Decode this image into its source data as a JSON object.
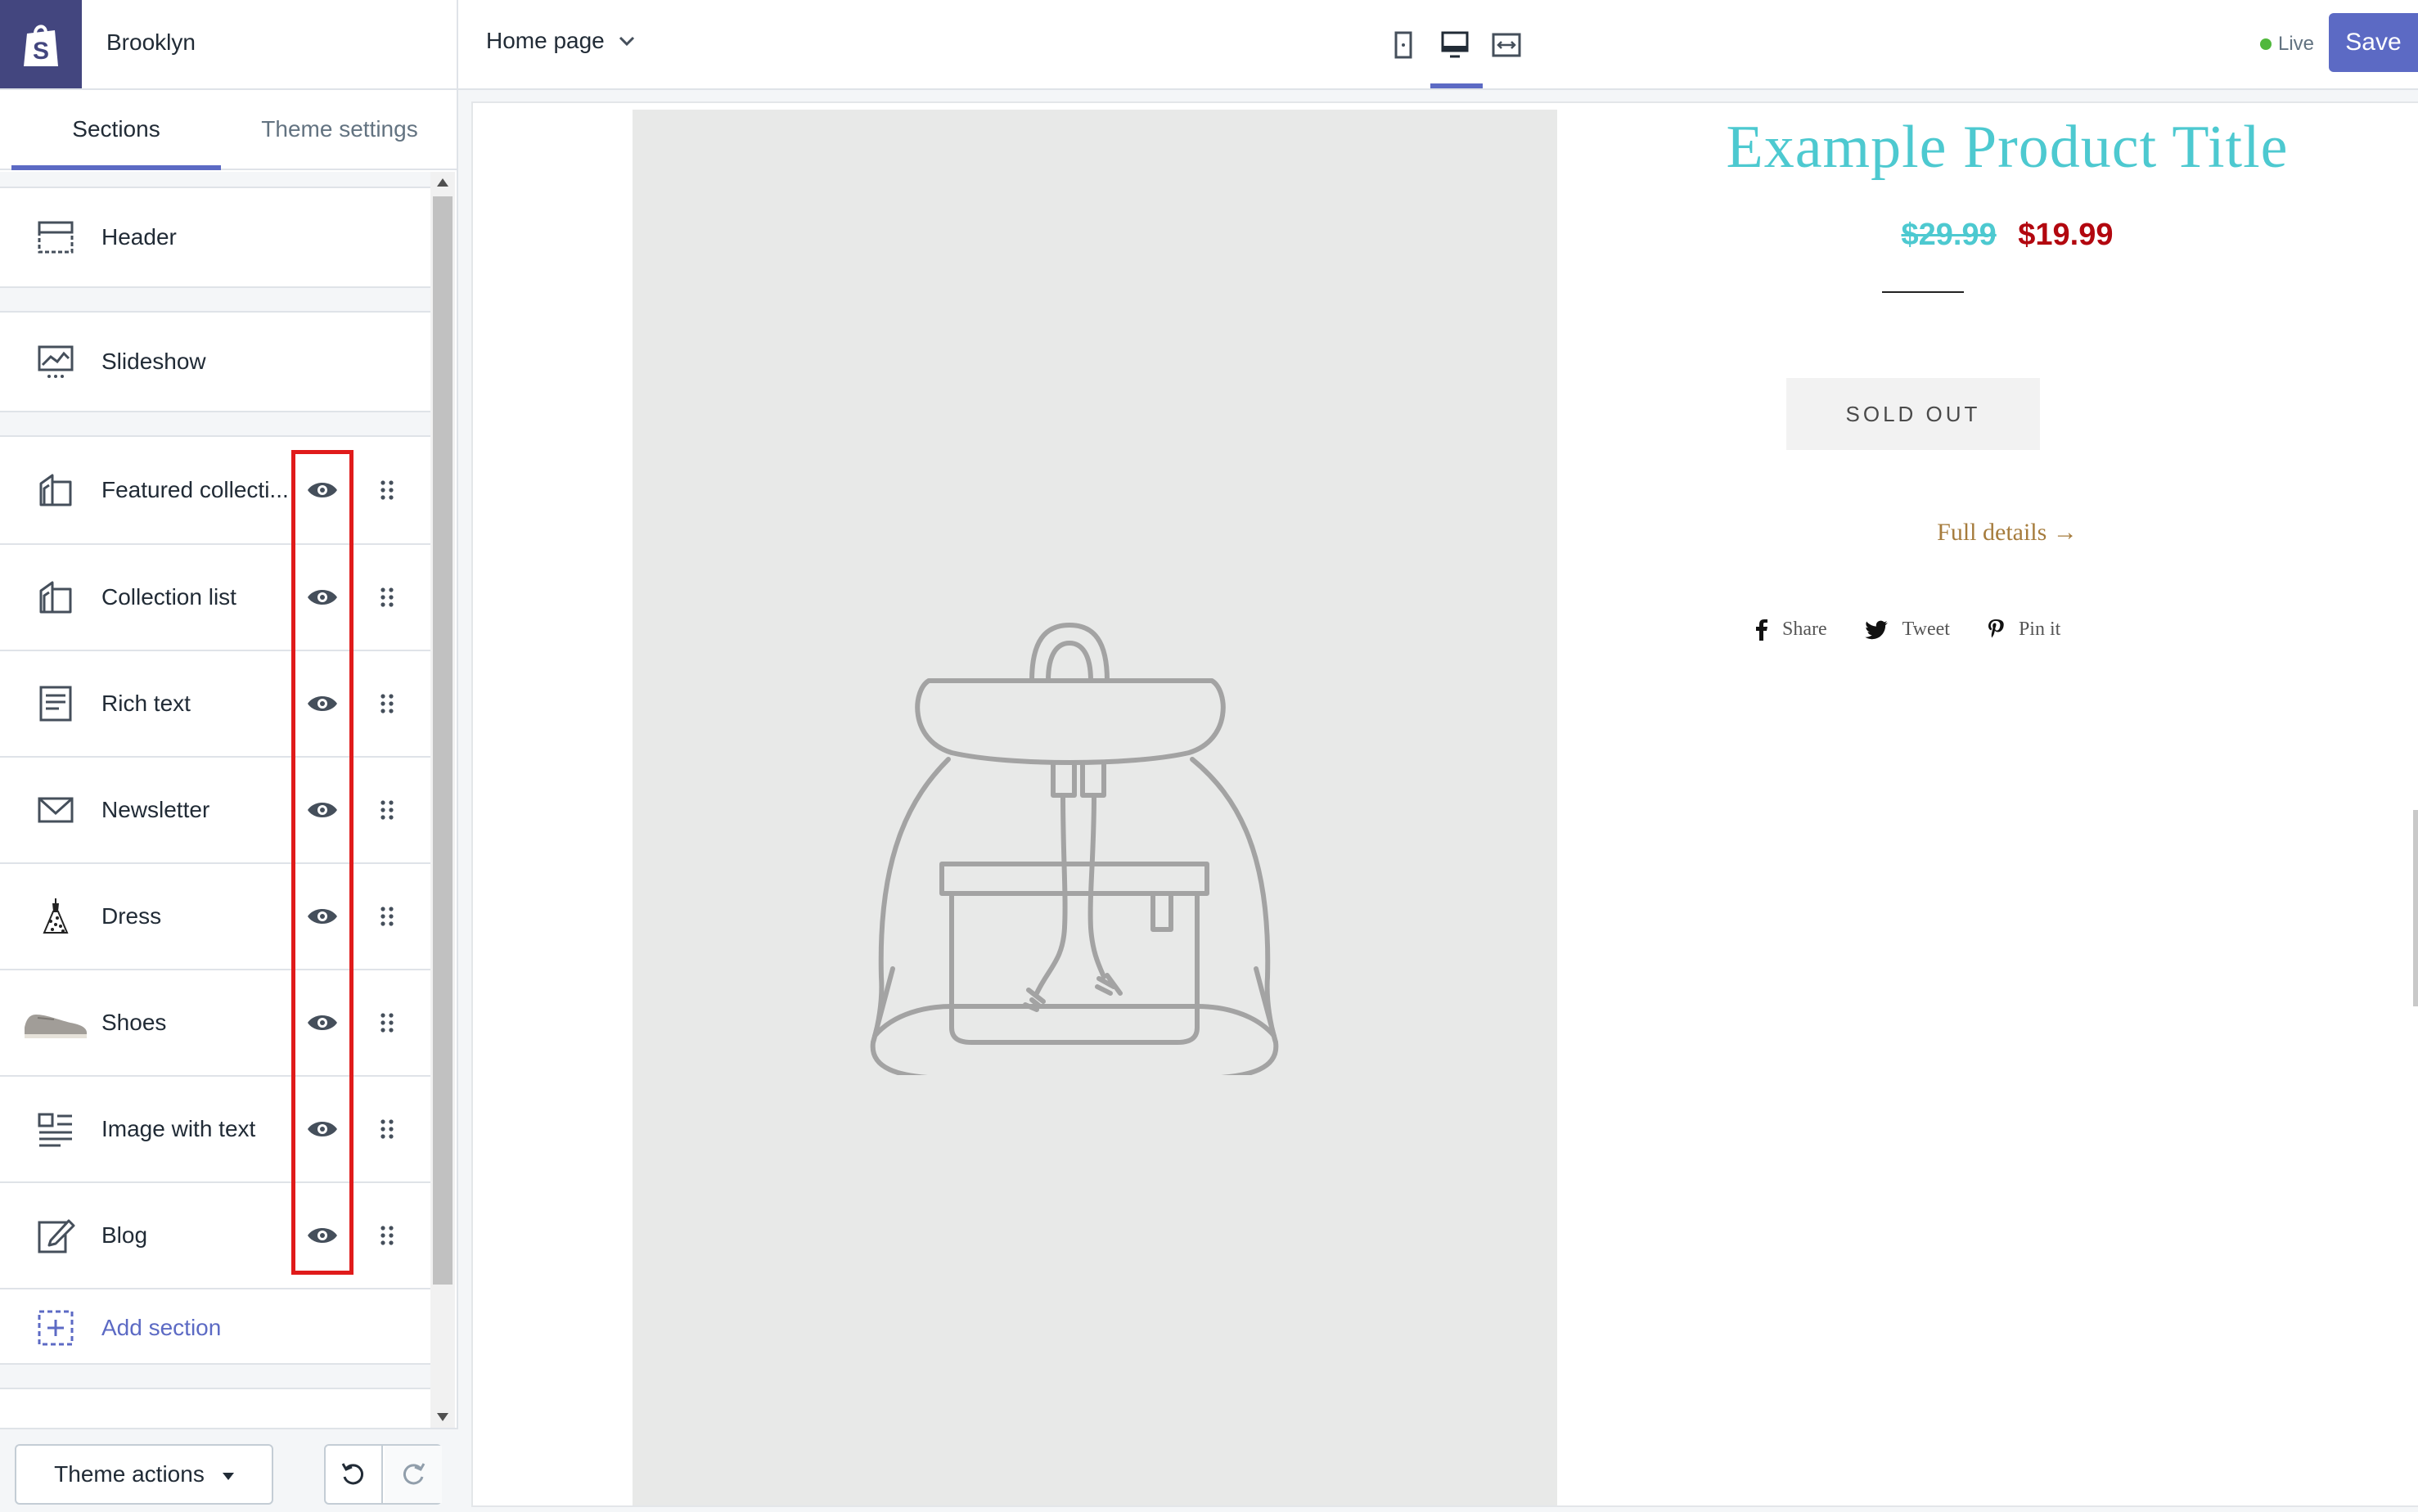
{
  "app": {
    "store_name": "Brooklyn"
  },
  "sidebar": {
    "tabs": [
      "Sections",
      "Theme settings"
    ],
    "fixed_sections": [
      "Header",
      "Slideshow"
    ],
    "sections": [
      {
        "label": "Featured collecti...",
        "icon": "collection-icon"
      },
      {
        "label": "Collection list",
        "icon": "collection-icon"
      },
      {
        "label": "Rich text",
        "icon": "rich-text-icon"
      },
      {
        "label": "Newsletter",
        "icon": "envelope-icon"
      },
      {
        "label": "Dress",
        "icon": "dress-thumbnail"
      },
      {
        "label": "Shoes",
        "icon": "shoes-thumbnail"
      },
      {
        "label": "Image with text",
        "icon": "image-text-icon"
      },
      {
        "label": "Blog",
        "icon": "blog-edit-icon"
      }
    ],
    "add_section": "Add section",
    "footer": {
      "theme_actions": "Theme actions"
    }
  },
  "topbar": {
    "page_select": "Home page",
    "status": "Live",
    "save_label": "Save",
    "active_device": "desktop"
  },
  "preview": {
    "product_title": "Example Product Title",
    "old_price": "$29.99",
    "new_price": "$19.99",
    "sold_out": "SOLD OUT",
    "full_details": "Full details →",
    "share": "Share",
    "tweet": "Tweet",
    "pin": "Pin it"
  },
  "colors": {
    "accent": "#5c6ac4",
    "title": "#4dc9d0",
    "sale_price": "#b2070f",
    "link": "#a67c3d",
    "highlight": "#e01b1b",
    "live": "#50b83c"
  }
}
